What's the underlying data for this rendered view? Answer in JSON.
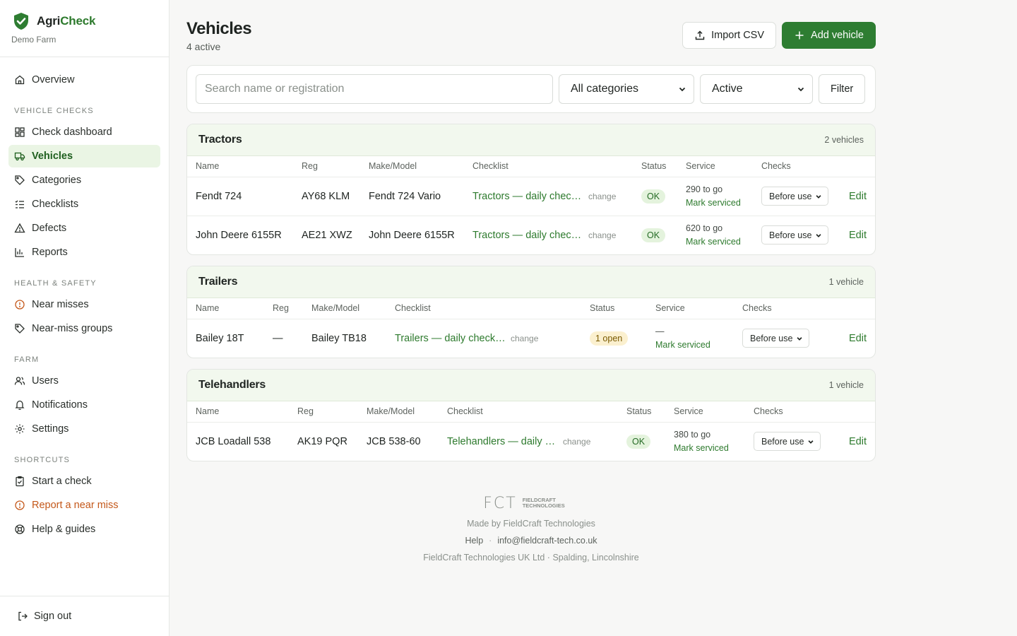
{
  "brand": {
    "name_part1": "Agri",
    "name_part2": "Check",
    "subtitle": "Demo Farm"
  },
  "nav": {
    "overview": "Overview",
    "section_vehicle_checks": "Vehicle checks",
    "check_dashboard": "Check dashboard",
    "vehicles": "Vehicles",
    "categories": "Categories",
    "checklists": "Checklists",
    "defects": "Defects",
    "reports": "Reports",
    "section_health_safety": "Health & safety",
    "near_misses": "Near misses",
    "near_miss_groups": "Near-miss groups",
    "section_farm": "Farm",
    "users": "Users",
    "notifications": "Notifications",
    "settings": "Settings",
    "section_shortcuts": "Shortcuts",
    "start_check": "Start a check",
    "report_near_miss": "Report a near miss",
    "help_guides": "Help & guides",
    "sign_out": "Sign out"
  },
  "header": {
    "title": "Vehicles",
    "subtitle": "4 active",
    "import_label": "Import CSV",
    "add_label": "Add vehicle"
  },
  "filters": {
    "search_placeholder": "Search name or registration",
    "category_value": "All categories",
    "status_value": "Active",
    "filter_label": "Filter"
  },
  "columns": {
    "name": "Name",
    "reg": "Reg",
    "make": "Make/Model",
    "checklist": "Checklist",
    "status": "Status",
    "service": "Service",
    "checks": "Checks"
  },
  "groups": [
    {
      "title": "Tractors",
      "count": "2 vehicles",
      "rows": [
        {
          "name": "Fendt 724",
          "reg": "AY68 KLM",
          "make": "Fendt 724 Vario",
          "checklist": "Tractors — daily check…",
          "change": "change",
          "status": "OK",
          "service_to_go": "290 to go",
          "mark": "Mark serviced",
          "checks": "Before use",
          "edit": "Edit"
        },
        {
          "name": "John Deere 6155R",
          "reg": "AE21 XWZ",
          "make": "John Deere 6155R",
          "checklist": "Tractors — daily check…",
          "change": "change",
          "status": "OK",
          "service_to_go": "620 to go",
          "mark": "Mark serviced",
          "checks": "Before use",
          "edit": "Edit"
        }
      ]
    },
    {
      "title": "Trailers",
      "count": "1 vehicle",
      "rows": [
        {
          "name": "Bailey 18T",
          "reg": "—",
          "make": "Bailey TB18",
          "checklist": "Trailers — daily check (…",
          "change": "change",
          "status": "1 open",
          "service_to_go": "—",
          "mark": "Mark serviced",
          "checks": "Before use",
          "edit": "Edit"
        }
      ]
    },
    {
      "title": "Telehandlers",
      "count": "1 vehicle",
      "rows": [
        {
          "name": "JCB Loadall 538",
          "reg": "AK19 PQR",
          "make": "JCB 538-60",
          "checklist": "Telehandlers — daily c…",
          "change": "change",
          "status": "OK",
          "service_to_go": "380 to go",
          "mark": "Mark serviced",
          "checks": "Before use",
          "edit": "Edit"
        }
      ]
    }
  ],
  "footer": {
    "logo_letters": "FCT",
    "logo_text_line1": "FIELDCRAFT",
    "logo_text_line2": "TECHNOLOGIES",
    "made_by": "Made by FieldCraft Technologies",
    "help": "Help",
    "email": "info@fieldcraft-tech.co.uk",
    "address": "FieldCraft Technologies UK Ltd · Spalding, Lincolnshire"
  },
  "colors": {
    "accent": "#2e7d32",
    "accent_text": "#2d7a2d",
    "warning": "#c4581a",
    "group_header_bg": "#f2f8ee"
  }
}
